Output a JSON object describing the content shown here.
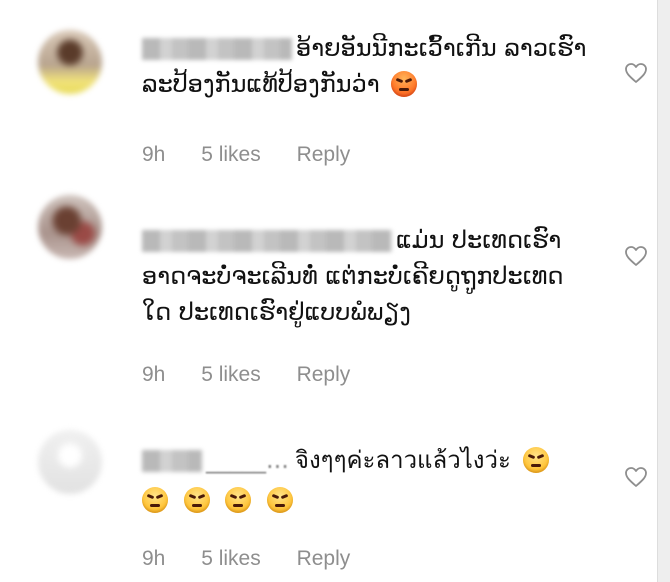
{
  "comments": [
    {
      "lines": [
        "ອ້າຍອັນນີກະເວົ້າເກີນ ລາວເຮົາ",
        "ລະປ້ອງກັນແທ້ປ້ອງກັນວ່າ"
      ],
      "emoji": "pouting-face",
      "time": "9h",
      "likes": "5 likes",
      "reply": "Reply"
    },
    {
      "lines": [
        "ແມ່ນ ປະເທດເຮົາ",
        "ອາດຈະບໍ່ຈະເລີນທໍ່ ແຕ່ກະບໍ່ເຄີຍດູຖູກປະເທດ",
        "ໃດ ປະເທດເຮົາຢູ່ແບບພໍພຽງ"
      ],
      "time": "9h",
      "likes": "5 likes",
      "reply": "Reply"
    },
    {
      "name_fragment": "_____...",
      "lines": [
        "จิงๆๆค่ะลาวแล้วไงว่ะ"
      ],
      "emoji": "angry-face",
      "emoji_row_count": 4,
      "time": "9h",
      "likes": "5 likes",
      "reply": "Reply"
    }
  ],
  "colors": {
    "meta_text": "#8e8e8e",
    "body_text": "#111111",
    "heart_stroke": "#8e8e8e"
  }
}
